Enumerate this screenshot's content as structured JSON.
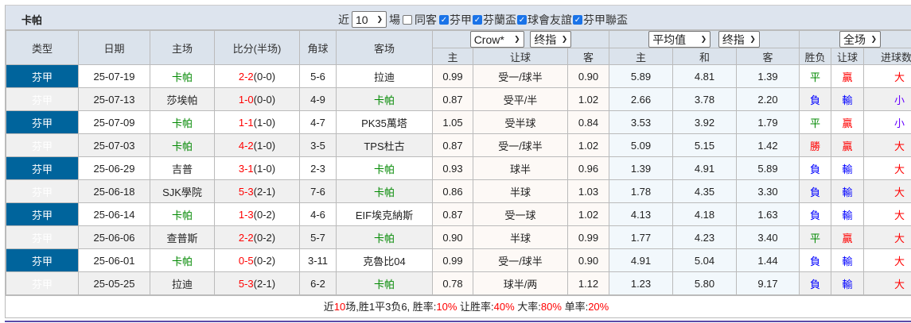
{
  "title": {
    "team": "卡帕"
  },
  "filters": {
    "recent_label": "近",
    "count": "10",
    "unit_label": "場",
    "same_venue": "同客",
    "same_venue_checked": false,
    "competitions": [
      {
        "label": "芬甲",
        "checked": true
      },
      {
        "label": "芬蘭盃",
        "checked": true
      },
      {
        "label": "球會友誼",
        "checked": true
      },
      {
        "label": "芬甲聯盃",
        "checked": true
      }
    ]
  },
  "header": {
    "type": "类型",
    "date": "日期",
    "home": "主场",
    "score": "比分(半场)",
    "corner": "角球",
    "away": "客场",
    "ah_company": "Crow*",
    "ah_kind": "终指",
    "eu_company": "平均值",
    "eu_kind": "终指",
    "scope": "全场",
    "ah_home": "主",
    "ah_line": "让球",
    "ah_away": "客",
    "eu_home": "主",
    "eu_draw": "和",
    "eu_away": "客",
    "result": "胜负",
    "handicap": "让球",
    "goals": "进球数"
  },
  "colors": {
    "type_bg": "#00649c",
    "team_highlight": "#008800",
    "win_red": "#ff0000",
    "lose_blue": "#0000ff"
  },
  "rows": [
    {
      "type": "芬甲",
      "date": "25-07-19",
      "home": "卡帕",
      "score": "2-2",
      "half": "(0-0)",
      "corner": "5-6",
      "away": "拉迪",
      "ah_h": "0.99",
      "ah_line": "受一/球半",
      "ah_a": "0.90",
      "eu_h": "5.89",
      "eu_d": "4.81",
      "eu_a": "1.39",
      "result": "平",
      "handicap": "贏",
      "goals": "大"
    },
    {
      "type": "芬甲",
      "date": "25-07-13",
      "home": "莎埃帕",
      "score": "1-0",
      "half": "(0-0)",
      "corner": "4-9",
      "away": "卡帕",
      "ah_h": "0.87",
      "ah_line": "受平/半",
      "ah_a": "1.02",
      "eu_h": "2.66",
      "eu_d": "3.78",
      "eu_a": "2.20",
      "result": "負",
      "handicap": "輸",
      "goals": "小"
    },
    {
      "type": "芬甲",
      "date": "25-07-09",
      "home": "卡帕",
      "score": "1-1",
      "half": "(1-0)",
      "corner": "4-7",
      "away": "PK35萬塔",
      "ah_h": "1.05",
      "ah_line": "受半球",
      "ah_a": "0.84",
      "eu_h": "3.53",
      "eu_d": "3.92",
      "eu_a": "1.79",
      "result": "平",
      "handicap": "贏",
      "goals": "小"
    },
    {
      "type": "芬甲",
      "date": "25-07-03",
      "home": "卡帕",
      "score": "4-2",
      "half": "(1-0)",
      "corner": "3-5",
      "away": "TPS杜古",
      "ah_h": "0.87",
      "ah_line": "受一/球半",
      "ah_a": "1.02",
      "eu_h": "5.09",
      "eu_d": "5.15",
      "eu_a": "1.42",
      "result": "勝",
      "handicap": "贏",
      "goals": "大"
    },
    {
      "type": "芬甲",
      "date": "25-06-29",
      "home": "吉普",
      "score": "3-1",
      "half": "(1-0)",
      "corner": "2-3",
      "away": "卡帕",
      "ah_h": "0.93",
      "ah_line": "球半",
      "ah_a": "0.96",
      "eu_h": "1.39",
      "eu_d": "4.91",
      "eu_a": "5.89",
      "result": "負",
      "handicap": "輸",
      "goals": "大"
    },
    {
      "type": "芬甲",
      "date": "25-06-18",
      "home": "SJK學院",
      "score": "5-3",
      "half": "(2-1)",
      "corner": "7-6",
      "away": "卡帕",
      "ah_h": "0.86",
      "ah_line": "半球",
      "ah_a": "1.03",
      "eu_h": "1.78",
      "eu_d": "4.35",
      "eu_a": "3.30",
      "result": "負",
      "handicap": "輸",
      "goals": "大"
    },
    {
      "type": "芬甲",
      "date": "25-06-14",
      "home": "卡帕",
      "score": "1-3",
      "half": "(0-2)",
      "corner": "4-6",
      "away": "EIF埃克納斯",
      "ah_h": "0.87",
      "ah_line": "受一球",
      "ah_a": "1.02",
      "eu_h": "4.13",
      "eu_d": "4.18",
      "eu_a": "1.63",
      "result": "負",
      "handicap": "輸",
      "goals": "大"
    },
    {
      "type": "芬甲",
      "date": "25-06-06",
      "home": "查普斯",
      "score": "2-2",
      "half": "(0-2)",
      "corner": "5-7",
      "away": "卡帕",
      "ah_h": "0.90",
      "ah_line": "半球",
      "ah_a": "0.99",
      "eu_h": "1.77",
      "eu_d": "4.23",
      "eu_a": "3.40",
      "result": "平",
      "handicap": "贏",
      "goals": "大"
    },
    {
      "type": "芬甲",
      "date": "25-06-01",
      "home": "卡帕",
      "score": "0-5",
      "half": "(0-2)",
      "corner": "3-11",
      "away": "克魯比04",
      "ah_h": "0.99",
      "ah_line": "受一/球半",
      "ah_a": "0.90",
      "eu_h": "4.91",
      "eu_d": "5.04",
      "eu_a": "1.44",
      "result": "負",
      "handicap": "輸",
      "goals": "大"
    },
    {
      "type": "芬甲",
      "date": "25-05-25",
      "home": "拉迪",
      "score": "5-3",
      "half": "(2-1)",
      "corner": "6-2",
      "away": "卡帕",
      "ah_h": "0.78",
      "ah_line": "球半/两",
      "ah_a": "1.12",
      "eu_h": "1.23",
      "eu_d": "5.80",
      "eu_a": "9.17",
      "result": "負",
      "handicap": "輸",
      "goals": "大"
    }
  ],
  "summary": {
    "p1": "近",
    "n": "10",
    "p2": "场,胜1平3负6, 胜率:",
    "win_rate": "10%",
    "p3": " 让胜率:",
    "ah_rate": "40%",
    "p4": " 大率:",
    "over_rate": "80%",
    "p5": " 单率:",
    "odd_rate": "20%"
  }
}
